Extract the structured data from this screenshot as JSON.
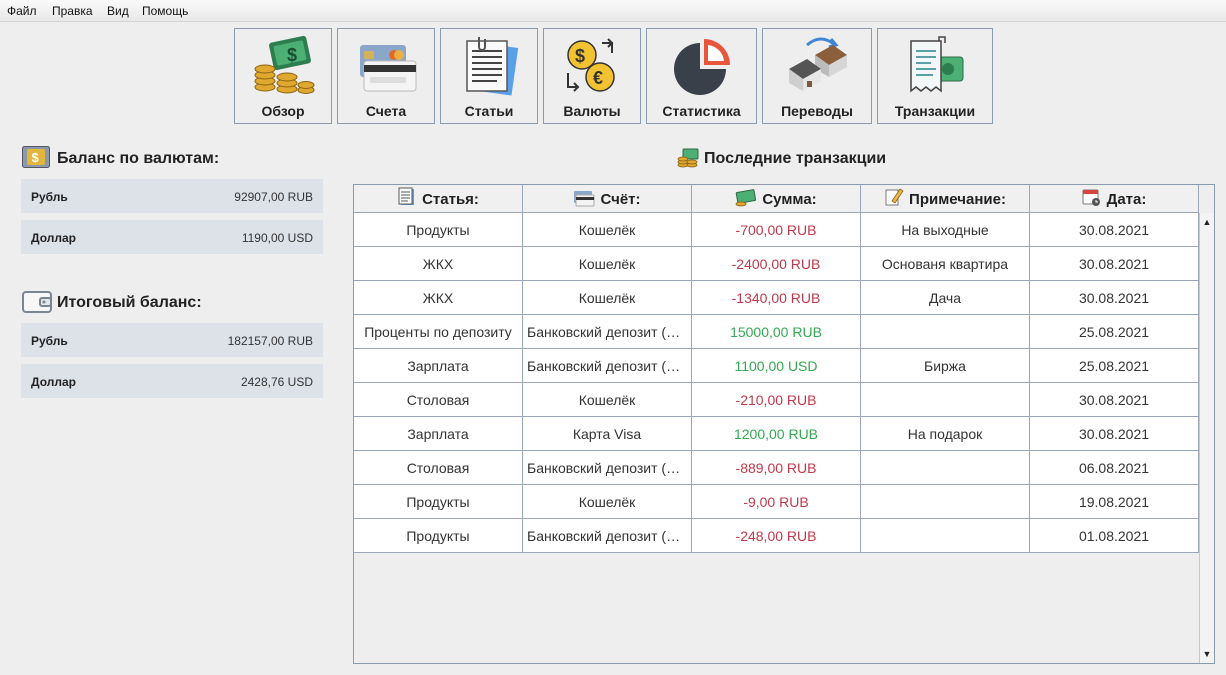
{
  "menu": [
    "Файл",
    "Правка",
    "Вид",
    "Помощь"
  ],
  "toolbar": [
    {
      "label": "Обзор",
      "icon": "money-coins-icon"
    },
    {
      "label": "Счета",
      "icon": "credit-card-icon"
    },
    {
      "label": "Статьи",
      "icon": "document-icon"
    },
    {
      "label": "Валюты",
      "icon": "currency-exchange-icon"
    },
    {
      "label": "Статистика",
      "icon": "pie-chart-icon"
    },
    {
      "label": "Переводы",
      "icon": "house-transfer-icon"
    },
    {
      "label": "Транзакции",
      "icon": "receipt-icon"
    }
  ],
  "balance_by_currency": {
    "title": "Баланс по валютам:",
    "rows": [
      {
        "name": "Рубль",
        "value": "92907,00 RUB"
      },
      {
        "name": "Доллар",
        "value": "1190,00 USD"
      }
    ]
  },
  "total_balance": {
    "title": "Итоговый баланс:",
    "rows": [
      {
        "name": "Рубль",
        "value": "182157,00 RUB"
      },
      {
        "name": "Доллар",
        "value": "2428,76 USD"
      }
    ]
  },
  "transactions": {
    "title": "Последние транзакции",
    "columns": [
      "Статья:",
      "Счёт:",
      "Сумма:",
      "Примечание:",
      "Дата:"
    ],
    "rows": [
      [
        "Продукты",
        "Кошелёк",
        "-700,00 RUB",
        "На выходные",
        "30.08.2021"
      ],
      [
        "ЖКХ",
        "Кошелёк",
        "-2400,00 RUB",
        "Основаня квартира",
        "30.08.2021"
      ],
      [
        "ЖКХ",
        "Кошелёк",
        "-1340,00 RUB",
        "Дача",
        "30.08.2021"
      ],
      [
        "Проценты по депозиту",
        "Банковский депозит (R...",
        "15000,00 RUB",
        "",
        "25.08.2021"
      ],
      [
        "Зарплата",
        "Банковский депозит (U...",
        "1100,00 USD",
        "Биржа",
        "25.08.2021"
      ],
      [
        "Столовая",
        "Кошелёк",
        "-210,00 RUB",
        "",
        "30.08.2021"
      ],
      [
        "Зарплата",
        "Карта Visa",
        "1200,00 RUB",
        "На подарок",
        "30.08.2021"
      ],
      [
        "Столовая",
        "Банковский депозит (R...",
        "-889,00 RUB",
        "",
        "06.08.2021"
      ],
      [
        "Продукты",
        "Кошелёк",
        "-9,00 RUB",
        "",
        "19.08.2021"
      ],
      [
        "Продукты",
        "Банковский депозит (R...",
        "-248,00 RUB",
        "",
        "01.08.2021"
      ]
    ]
  },
  "colors": {
    "negative": "#c0394b",
    "positive": "#34a853",
    "row_bg": "#dde1e8",
    "border": "#8a9bb0"
  }
}
